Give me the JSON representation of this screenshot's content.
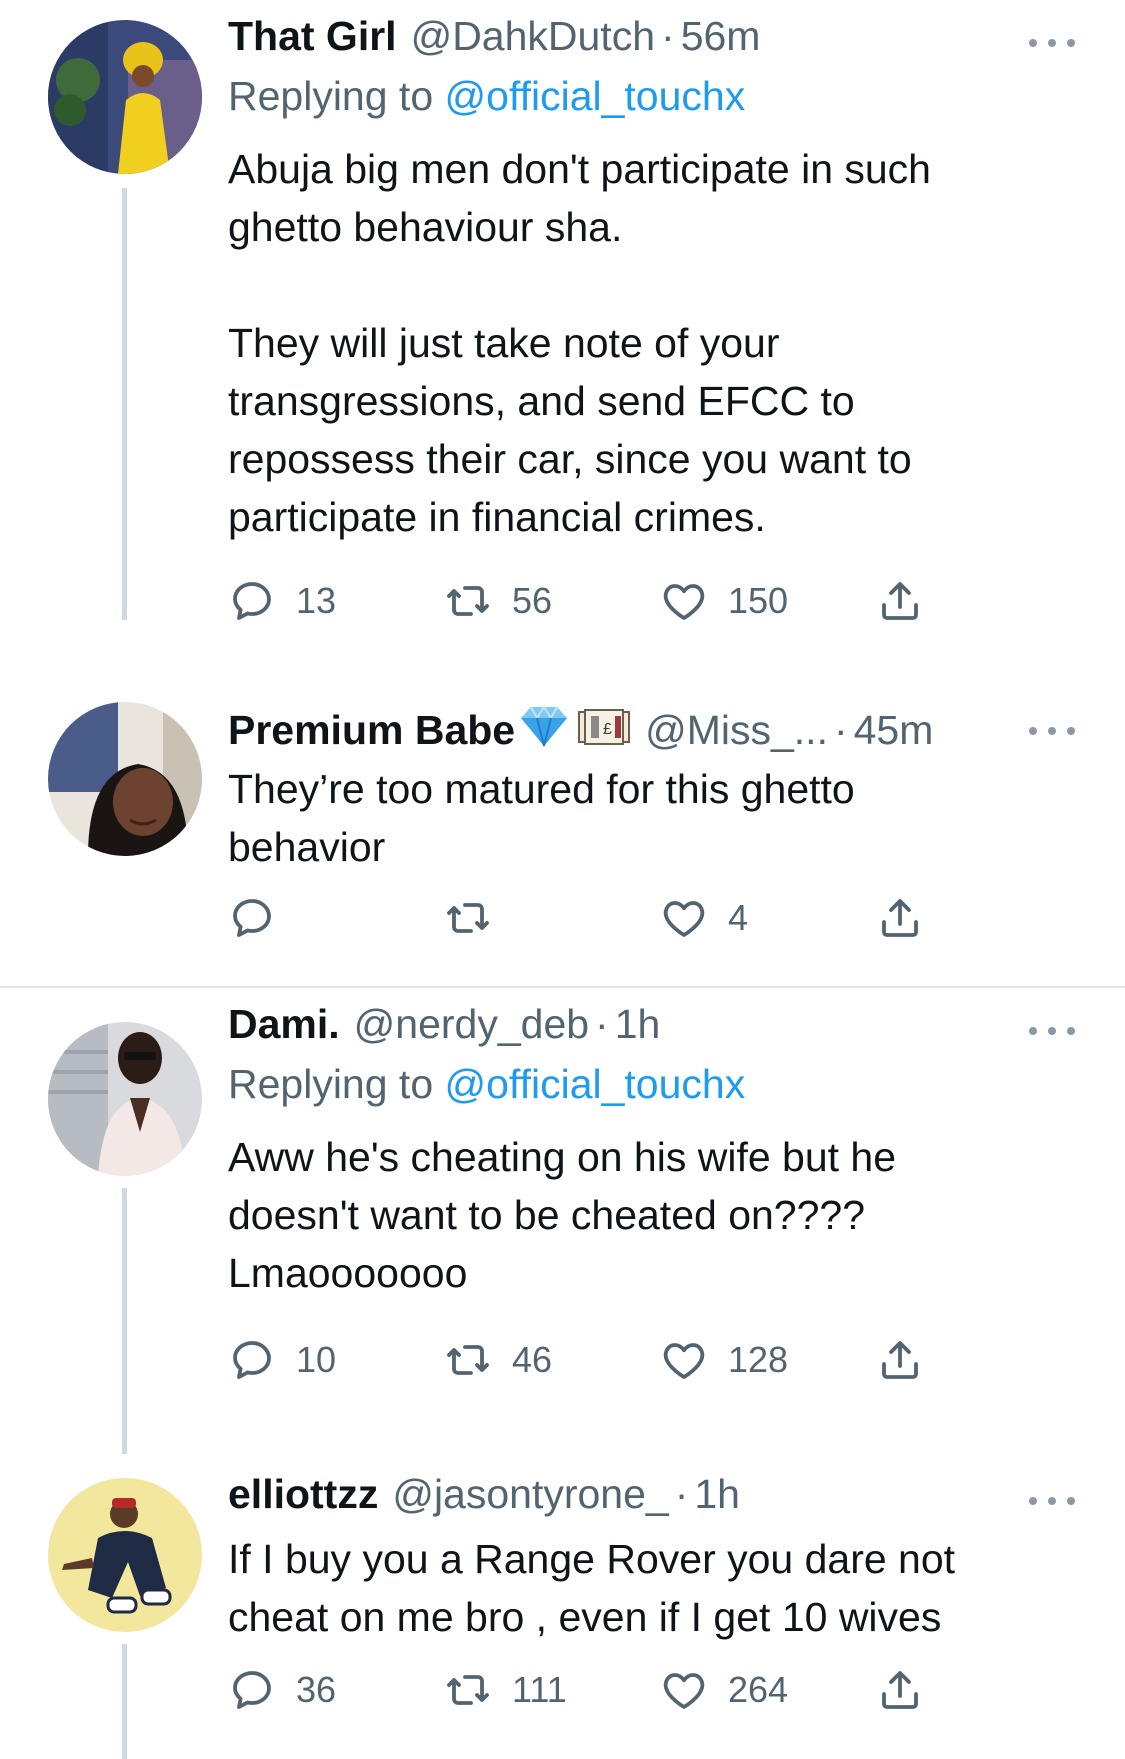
{
  "tweets": [
    {
      "name": "That Girl",
      "handle": "@DahkDutch",
      "dot": "·",
      "time": "56m",
      "replying_prefix": "Replying to ",
      "replying_to": "@official_touchx",
      "body": "Abuja big men don't participate in such\nghetto behaviour sha.\n\nThey will just take note of your\ntransgressions, and send EFCC to\nrepossess their car, since you want to\nparticipate in financial crimes.",
      "replies": "13",
      "retweets": "56",
      "likes": "150"
    },
    {
      "name": "Premium Babe",
      "name_emojis": [
        "gem-emoji",
        "money-emoji"
      ],
      "handle": "@Miss_...",
      "dot": "·",
      "time": "45m",
      "body": "They’re too matured for this ghetto\nbehavior",
      "replies": "",
      "retweets": "",
      "likes": "4"
    },
    {
      "name": "Dami.",
      "handle": "@nerdy_deb",
      "dot": "·",
      "time": "1h",
      "replying_prefix": "Replying to ",
      "replying_to": "@official_touchx",
      "body": "Aww he's cheating on his wife but he\ndoesn't want to be cheated on????\nLmaooooooo",
      "replies": "10",
      "retweets": "46",
      "likes": "128"
    },
    {
      "name": "elliottzz",
      "handle": "@jasontyrone_",
      "dot": "·",
      "time": "1h",
      "body": "If I buy you a Range Rover you dare not\ncheat on me bro , even if I get 10 wives",
      "replies": "36",
      "retweets": "111",
      "likes": "264"
    }
  ],
  "icons": {
    "reply": "reply-icon",
    "retweet": "retweet-icon",
    "like": "heart-icon",
    "share": "share-icon",
    "more": "more-icon"
  },
  "colors": {
    "text": "#0f1419",
    "secondary": "#536471",
    "link": "#1d9bf0",
    "thread_line": "#cfd9de",
    "divider": "#e1e6ea"
  }
}
